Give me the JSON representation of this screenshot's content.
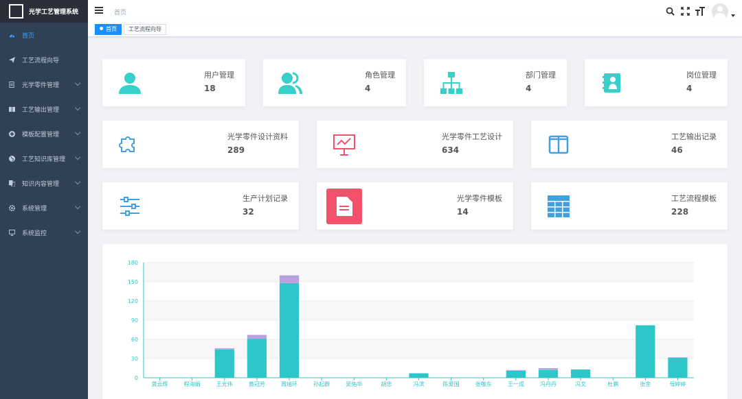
{
  "app": {
    "title": "光学工艺管理系统"
  },
  "sidebar": {
    "items": [
      {
        "label": "首页",
        "icon": "dashboard-icon",
        "active": true,
        "arrow": false
      },
      {
        "label": "工艺流程向导",
        "icon": "send-icon",
        "active": false,
        "arrow": false
      },
      {
        "label": "光学零件管理",
        "icon": "document-icon",
        "active": false,
        "arrow": true
      },
      {
        "label": "工艺输出管理",
        "icon": "book-icon",
        "active": false,
        "arrow": true
      },
      {
        "label": "模板配置管理",
        "icon": "plus-circle-icon",
        "active": false,
        "arrow": true
      },
      {
        "label": "工艺知识库管理",
        "icon": "globe-icon",
        "active": false,
        "arrow": true
      },
      {
        "label": "知识内容管理",
        "icon": "copy-icon",
        "active": false,
        "arrow": true
      },
      {
        "label": "系统管理",
        "icon": "gear-icon",
        "active": false,
        "arrow": true
      },
      {
        "label": "系统监控",
        "icon": "monitor-icon",
        "active": false,
        "arrow": true
      }
    ]
  },
  "navbar": {
    "breadcrumb": "首页"
  },
  "tags": [
    {
      "label": "首页",
      "active": true
    },
    {
      "label": "工艺流程向导",
      "active": false
    }
  ],
  "stats_row1": [
    {
      "label": "用户管理",
      "value": "18",
      "icon": "user-icon",
      "color": "#36cfc9"
    },
    {
      "label": "角色管理",
      "value": "4",
      "icon": "users-icon",
      "color": "#36cfc9"
    },
    {
      "label": "部门管理",
      "value": "4",
      "icon": "org-chart-icon",
      "color": "#36cfc9"
    },
    {
      "label": "岗位管理",
      "value": "4",
      "icon": "badge-icon",
      "color": "#36cfc9"
    }
  ],
  "stats_row2": [
    {
      "label": "光学零件设计资料",
      "value": "289",
      "icon": "puzzle-icon",
      "color": "#40a0e0"
    },
    {
      "label": "光学零件工艺设计",
      "value": "634",
      "icon": "presentation-icon",
      "color": "#f4516c"
    },
    {
      "label": "工艺输出记录",
      "value": "46",
      "icon": "columns-icon",
      "color": "#40a0e0"
    }
  ],
  "stats_row3": [
    {
      "label": "生产计划记录",
      "value": "32",
      "icon": "sliders-icon",
      "color": "#40a0e0"
    },
    {
      "label": "光学零件模板",
      "value": "14",
      "icon": "file-text-icon",
      "color": "#f4516c"
    },
    {
      "label": "工艺流程模板",
      "value": "228",
      "icon": "table-icon",
      "color": "#40a0e0"
    }
  ],
  "chart_data": {
    "type": "bar",
    "stacked": true,
    "categories": [
      "龚云辉",
      "程海娟",
      "王光伟",
      "黄冠芳",
      "周旭环",
      "孙起群",
      "吴佑华",
      "胡忠",
      "冯滨",
      "陈爱国",
      "张敬东",
      "王一成",
      "冯丹丹",
      "冯文",
      "杜鹏",
      "张金",
      "母婷婷"
    ],
    "series": [
      {
        "color": "#2ec7c9",
        "values": [
          0,
          0,
          44,
          61,
          148,
          0,
          0,
          0,
          7,
          0,
          0,
          11,
          12,
          13,
          0,
          82,
          31
        ]
      },
      {
        "color": "#b6a2de",
        "values": [
          0,
          0,
          2,
          6,
          12,
          0,
          0,
          0,
          0,
          0,
          0,
          1,
          3,
          0,
          0,
          0,
          1
        ]
      }
    ],
    "ylim": [
      0,
      180
    ],
    "yticks": [
      0,
      30,
      60,
      90,
      120,
      150,
      180
    ],
    "grid": true
  }
}
